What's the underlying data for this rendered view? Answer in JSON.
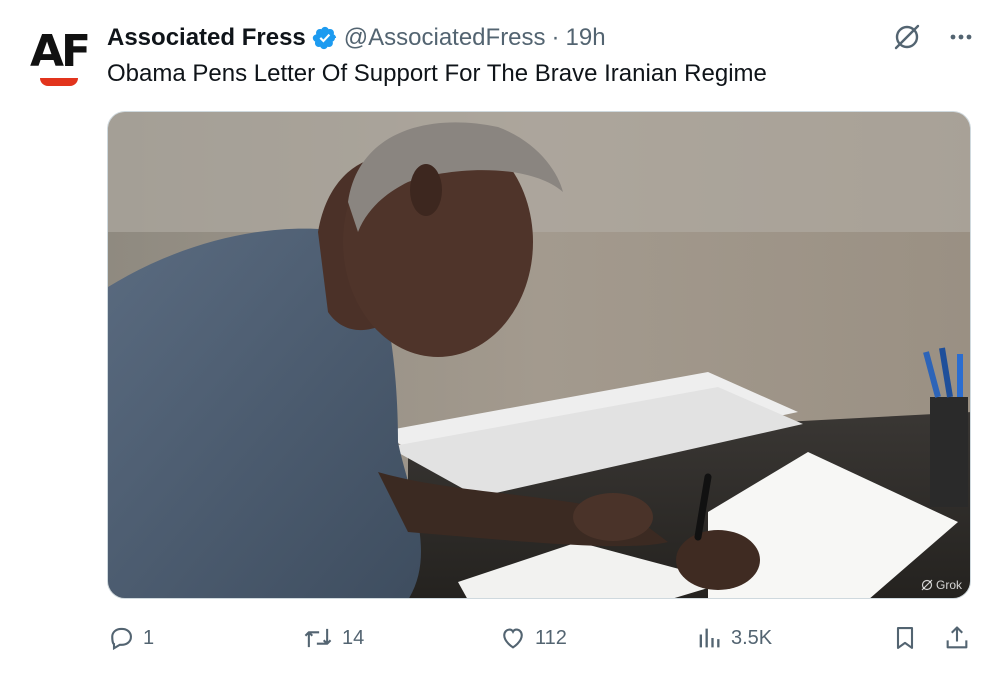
{
  "account": {
    "name": "Associated Fress",
    "handle": "@AssociatedFress",
    "separator": "·",
    "time": "19h",
    "avatar_text": "AF",
    "verified_icon": "verified-badge-icon",
    "brand_color": "#e2341d"
  },
  "tweet": {
    "text": "Obama Pens Letter Of Support For The Brave Iranian Regime"
  },
  "media": {
    "watermark": "Grok"
  },
  "actions": {
    "reply_count": "1",
    "retweet_count": "14",
    "like_count": "112",
    "views_count": "3.5K"
  },
  "colors": {
    "verified": "#1d9bf0",
    "muted": "#536471",
    "text": "#0f1419"
  }
}
